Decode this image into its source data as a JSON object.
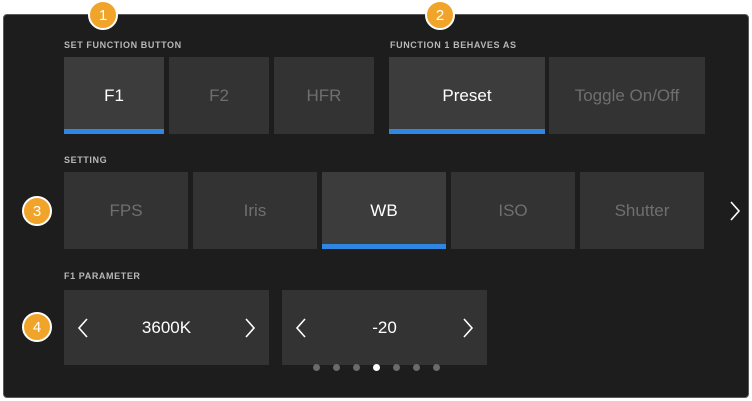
{
  "function_button": {
    "section_label": "SET FUNCTION BUTTON",
    "buttons": [
      "F1",
      "F2",
      "HFR"
    ],
    "selected": "F1"
  },
  "behaves_as": {
    "section_label": "FUNCTION 1 BEHAVES AS",
    "buttons": [
      "Preset",
      "Toggle On/Off"
    ],
    "selected": "Preset"
  },
  "setting": {
    "section_label": "SETTING",
    "buttons": [
      "FPS",
      "Iris",
      "WB",
      "ISO",
      "Shutter"
    ],
    "selected": "WB"
  },
  "parameter": {
    "section_label": "F1 PARAMETER",
    "white_balance_value": "3600K",
    "tint_value": "-20"
  },
  "badges": [
    "1",
    "2",
    "3",
    "4"
  ],
  "pagination": {
    "total": 7,
    "current_index": 3
  },
  "icons": {
    "scroll_right": "chevron-right-icon",
    "decrement": "chevron-left-icon",
    "increment": "chevron-right-icon"
  },
  "colors": {
    "accent": "#2f86e3",
    "badge": "#f0a52a"
  }
}
